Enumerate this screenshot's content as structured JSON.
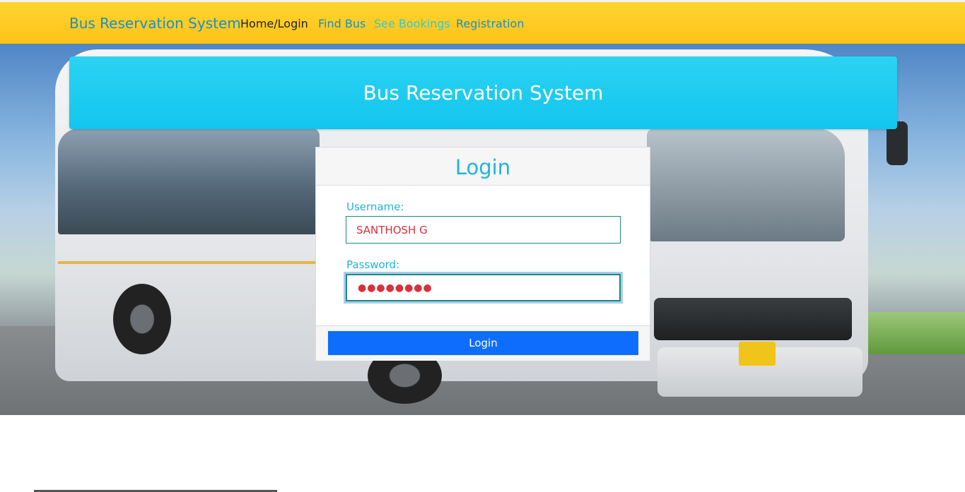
{
  "navbar": {
    "brand": "Bus Reservation System",
    "links": [
      "Home/Login",
      "Find Bus",
      "See Bookings",
      "Registration"
    ]
  },
  "banner": {
    "title": "Bus Reservation System"
  },
  "login": {
    "title": "Login",
    "username_label": "Username:",
    "username_value": "SANTHOSH G",
    "password_label": "Password:",
    "password_masked": "●●●●●●●●",
    "button_label": "Login"
  },
  "colors": {
    "navbar": "#ffc21a",
    "banner": "#13c5ee",
    "accent_text": "#1fb4dc",
    "button": "#0d6efd"
  }
}
